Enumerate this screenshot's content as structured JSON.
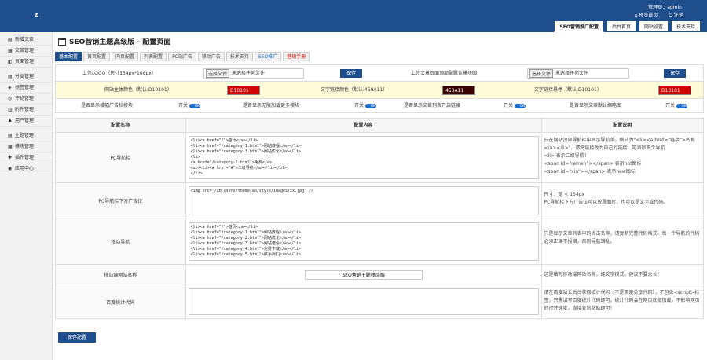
{
  "header": {
    "logo": "z",
    "admin": "管理员：admin",
    "links": [
      "预览首页",
      "注销"
    ],
    "tabs": [
      "SEO营销推广配置",
      "后台首页",
      "网站设置",
      "技术支持"
    ]
  },
  "sidebar": {
    "items": [
      {
        "icon": "▤",
        "label": "新增文章"
      },
      {
        "icon": "▦",
        "label": "文章管理"
      },
      {
        "icon": "◧",
        "label": "页面管理"
      },
      {
        "icon": "▤",
        "label": "分类管理"
      },
      {
        "icon": "◈",
        "label": "标签管理"
      },
      {
        "icon": "◎",
        "label": "评论管理"
      },
      {
        "icon": "▥",
        "label": "附件管理"
      },
      {
        "icon": "♟",
        "label": "用户管理"
      },
      {
        "icon": "▤",
        "label": "主题管理"
      },
      {
        "icon": "▦",
        "label": "模块管理"
      },
      {
        "icon": "✚",
        "label": "插件管理"
      },
      {
        "icon": "◉",
        "label": "应用中心"
      }
    ]
  },
  "page": {
    "title": "SEO营销主题高级版 - 配置页面",
    "tabs": [
      {
        "label": "基本配置",
        "style": "active"
      },
      {
        "label": "首页配置",
        "style": ""
      },
      {
        "label": "内页配置",
        "style": ""
      },
      {
        "label": "列表配置",
        "style": ""
      },
      {
        "label": "PC端广告",
        "style": ""
      },
      {
        "label": "移动广告",
        "style": ""
      },
      {
        "label": "技术支持",
        "style": ""
      },
      {
        "label": "SEO推广",
        "style": "blue"
      },
      {
        "label": "营销手册",
        "style": "red"
      }
    ]
  },
  "upload": {
    "logo_label": "上传LOGO（尺寸154px*108px）",
    "file_btn": "选择文件",
    "file_none": "未选择任何文件",
    "save": "保存",
    "banner_label": "上传文章页面顶部配默认模块图",
    "file_btn2": "选择文件",
    "file_none2": "未选择任何文件",
    "save2": "保存"
  },
  "colors": {
    "main_label": "网站主体颜色（默认:D10101）",
    "main_value": "D10101",
    "text_label": "文字链接颜色（默认:450A11）",
    "text_value": "450A11",
    "hover_label": "文字链接悬停（默认:D10101）",
    "hover_value": "D10101",
    "accent": "#d10101",
    "dark": "#3a0000"
  },
  "toggles": [
    {
      "label": "是否显示横幅广告栏模块",
      "state": "开关"
    },
    {
      "label": "是否显示无限加载更多模块",
      "state": "开关"
    },
    {
      "label": "是否显示文章列表开启链接",
      "state": "开关"
    },
    {
      "label": "是否显示文章默认缩略图",
      "state": "开关"
    }
  ],
  "table": {
    "headers": [
      "配置名称",
      "配置内容",
      "配置说明"
    ],
    "rows": [
      {
        "name": "PC导航栏",
        "content": "<li><a href=\"/\">首页</a></li>\n<li><a href=\"/category-1.html\">网站教程</a></li>\n<li><a href=\"/category-3.html\">网站优化</a></li>\n<li>\n<a href=\"/category-2.html\">免费</a>\n<ul><li><a href=\"#\">二级导航</a></li></ul>\n</li>",
        "desc": "只在网站顶部导航栏中显示导航条，格式为\"<li><a href=\"链接\">名称</a></li>\"，请将链接改为自己的链接，可添加多个导航\n<li> 表示二级导航！\n<span id=\"remen\"></span> 表示hot图标\n<span id=\"xin\"></span> 表示new图标"
      },
      {
        "name": "PC导航栏下方广告位",
        "content": "<img src=\"/zb_users/theme/ab/style/images/xx.jpg\" />",
        "desc": "尺寸：宽 < 154px\nPC导航栏下方广告位可以放置图片，也可以是文字或代码。"
      },
      {
        "name": "移动导航",
        "content": "<li><a href=\"/\">首页</a></li>\n<li><a href=\"/category-1.html\">网站教程</a></li>\n<li><a href=\"/category-2.html\">网站优化</a></li>\n<li><a href=\"/category-3.html\">网站建设</a></li>\n<li><a href=\"/category-4.html\">免费下载</a></li>\n<li><a href=\"/category-5.html\">联系我们</a></li>",
        "desc": "只是显示文章列表中的点击名称，请复制完整代码格式，每一个导航的代码必须正确不报错，否则导航错乱。"
      },
      {
        "name": "移动端网站名称",
        "content": "SEO营销主题移动端",
        "desc": "这是填写移动端网站名称，纯文字模式，建议不要太长！"
      },
      {
        "name": "百度统计代码",
        "content": "",
        "desc": "请在百度站长后台获取统计代码（不是百度分享代码），不包含<script>标签，只需填写百度统计代码即可，统计代码会在网页底部加载，不影响网页的打开速度，直接复制粘贴即可！"
      }
    ]
  },
  "footer": {
    "save": "保存配置"
  }
}
